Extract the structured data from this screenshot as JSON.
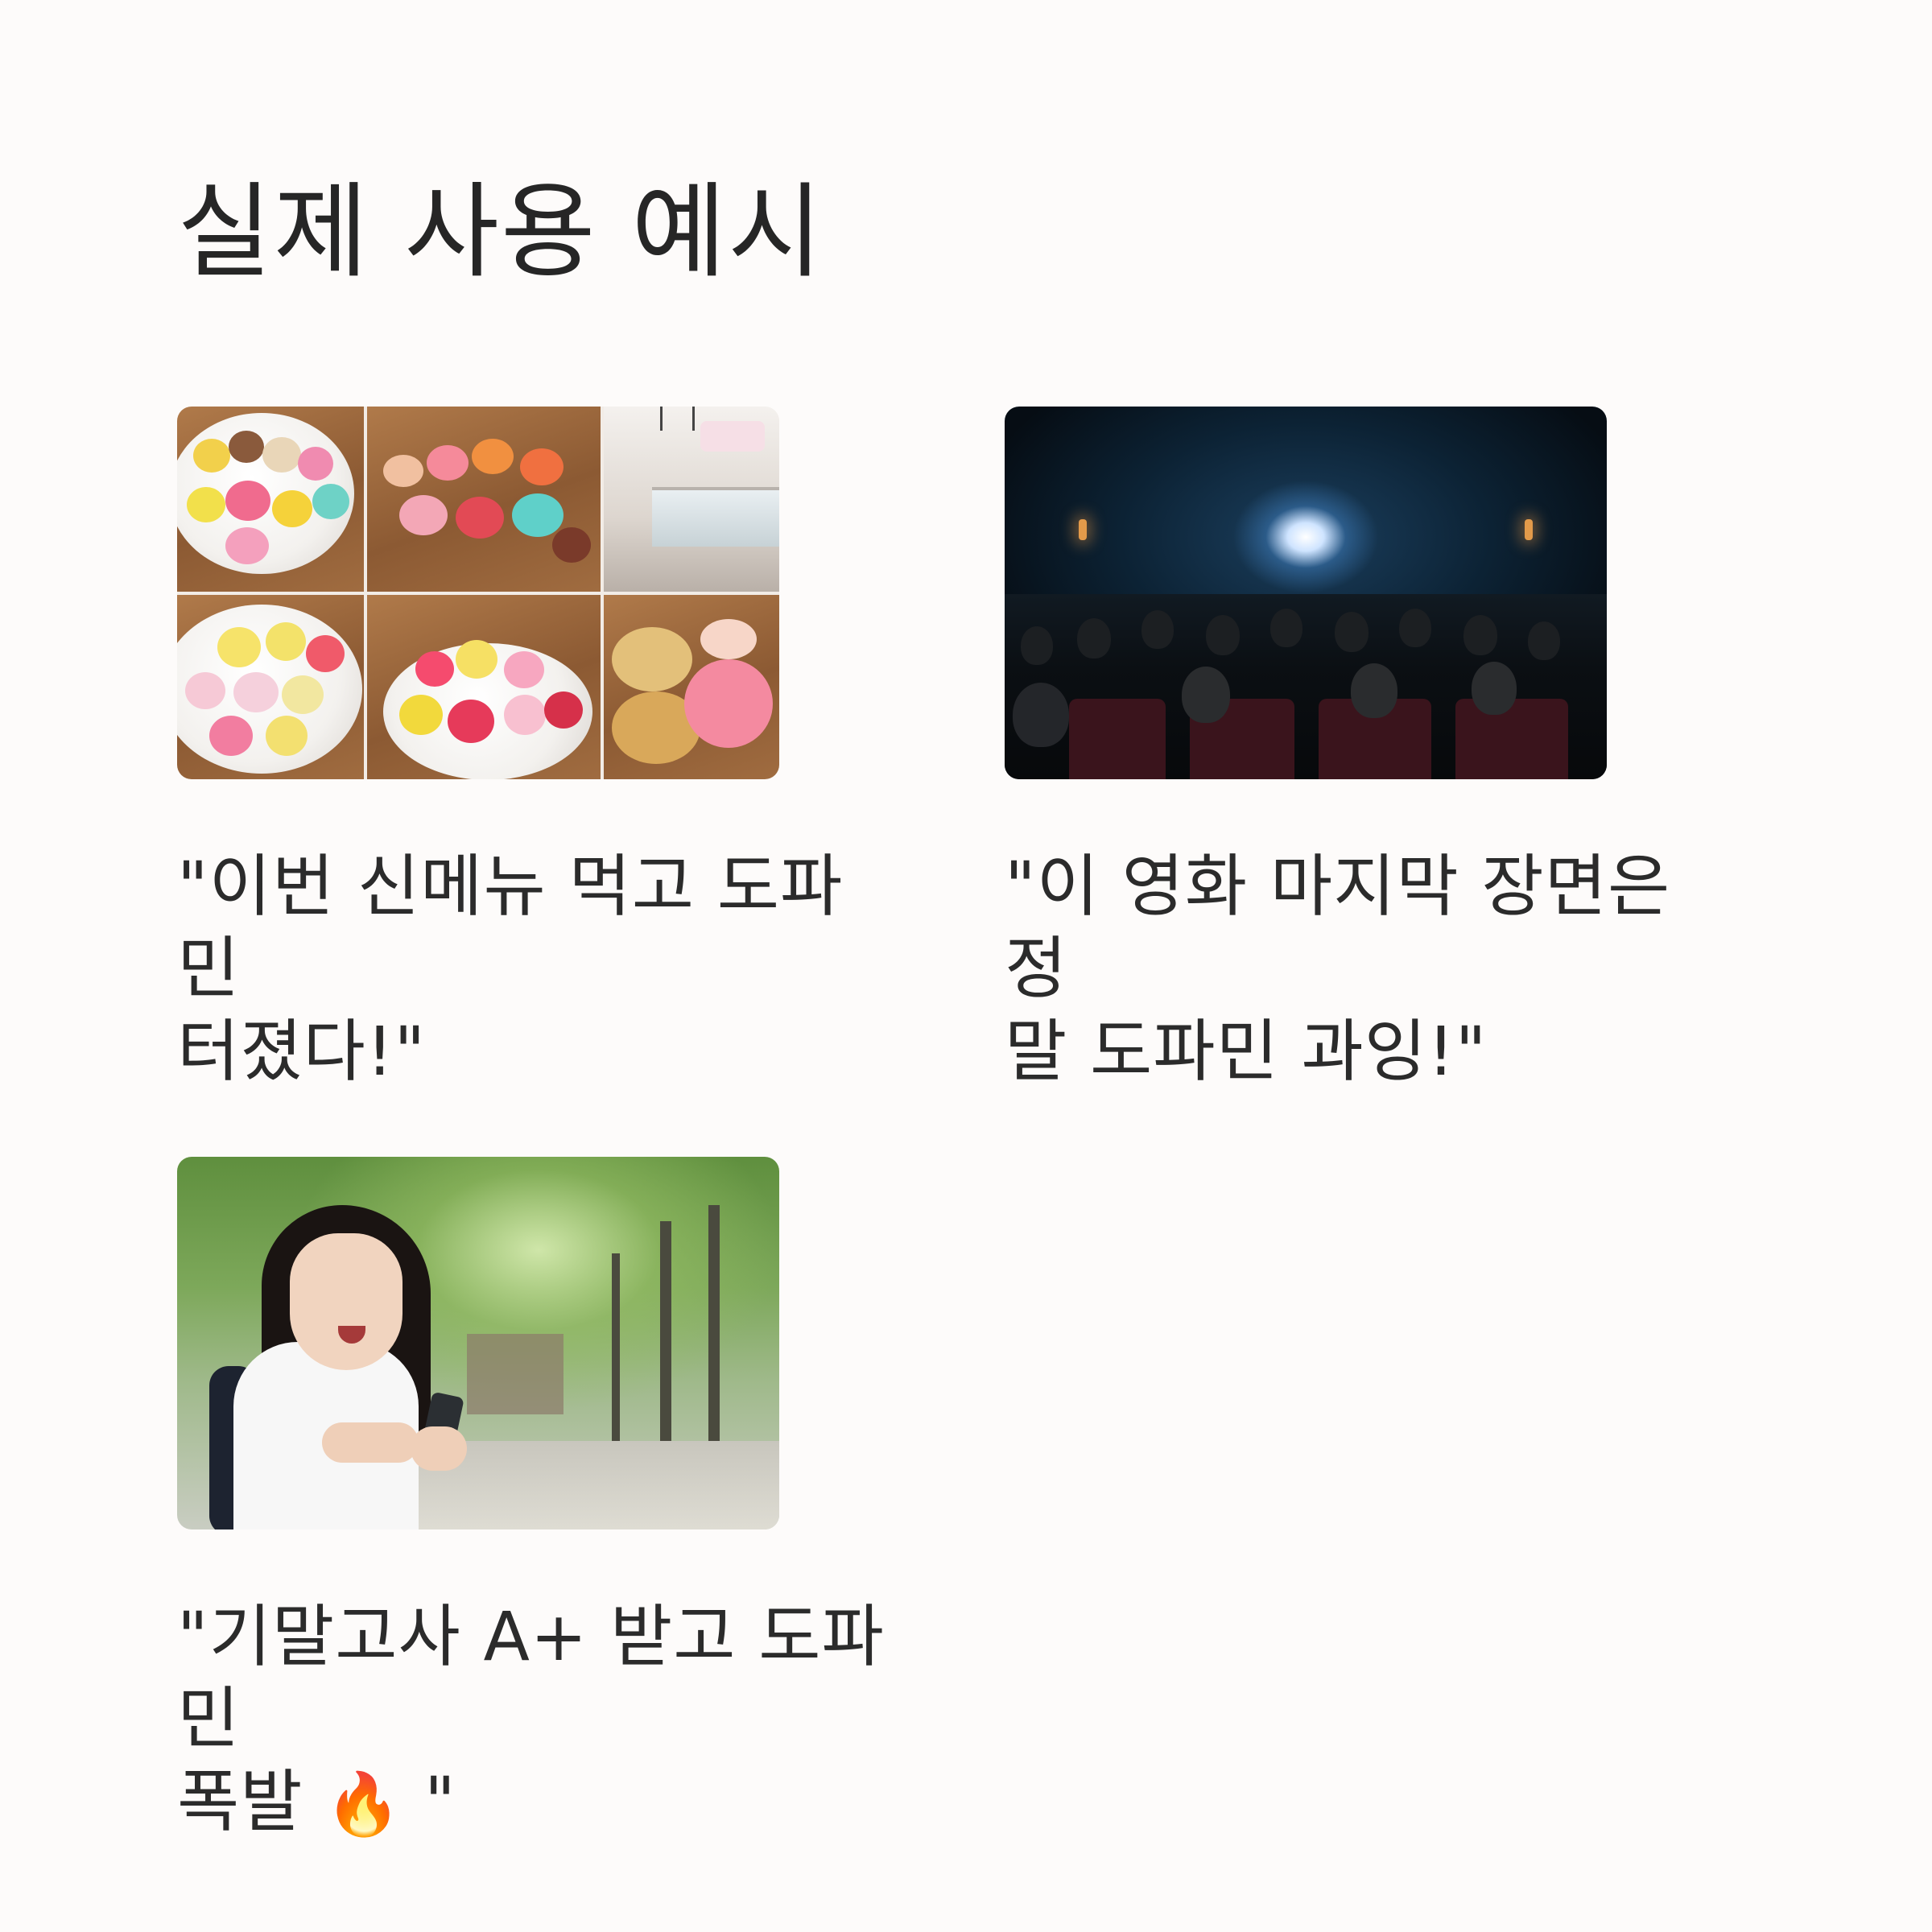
{
  "page": {
    "title": "실제 사용 예시"
  },
  "examples": [
    {
      "caption_line1": "\"이번 신메뉴 먹고 도파민",
      "caption_line2": "터졌다!\"",
      "image": "dessert-collage"
    },
    {
      "caption_line1": "\"이 영화 마지막 장면은 정",
      "caption_line2": "말 도파민 과잉!\"",
      "image": "cinema-audience"
    },
    {
      "caption_line1": "\"기말고사 A+ 받고 도파민",
      "caption_line2_text": "폭발 ",
      "caption_line2_emoji": "🔥",
      "caption_line2_end": " \"",
      "image": "student-phone-park"
    }
  ],
  "colors": {
    "background": "#fdfbfa",
    "text": "#2b2b2b"
  }
}
